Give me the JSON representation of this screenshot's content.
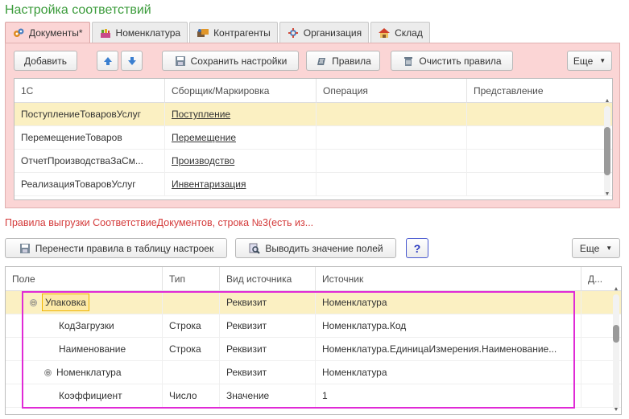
{
  "page_title": "Настройка соответствий",
  "tabs": [
    {
      "label": "Документы*",
      "icon": "documents-icon",
      "active": true
    },
    {
      "label": "Номенклатура",
      "icon": "nomenclature-icon"
    },
    {
      "label": "Контрагенты",
      "icon": "counterparties-icon"
    },
    {
      "label": "Организация",
      "icon": "organization-icon"
    },
    {
      "label": "Склад",
      "icon": "warehouse-icon"
    }
  ],
  "toolbar": {
    "add": "Добавить",
    "save_settings": "Сохранить настройки",
    "rules": "Правила",
    "clear_rules": "Очистить правила",
    "more": "Еще"
  },
  "docs_table": {
    "columns": [
      "1С",
      "Сборщик/Маркировка",
      "Операция",
      "Представление"
    ],
    "rows": [
      {
        "c1": "ПоступлениеТоваровУслуг",
        "c2": "Поступление",
        "c3": "",
        "c4": "",
        "selected": true
      },
      {
        "c1": "ПеремещениеТоваров",
        "c2": "Перемещение",
        "c3": "",
        "c4": ""
      },
      {
        "c1": "ОтчетПроизводстваЗаСм...",
        "c2": "Производство",
        "c3": "",
        "c4": ""
      },
      {
        "c1": "РеализацияТоваровУслуг",
        "c2": "Инвентаризация",
        "c3": "",
        "c4": ""
      }
    ]
  },
  "rules_title": "Правила выгрузки СоответствиеДокументов, строка №3(есть из...",
  "rules_toolbar": {
    "transfer": "Перенести правила в таблицу настроек",
    "show_values": "Выводить значение полей",
    "help": "?",
    "more": "Еще"
  },
  "fields_table": {
    "columns": [
      "Поле",
      "Тип",
      "Вид источника",
      "Источник",
      "Д..."
    ],
    "rows": [
      {
        "field": "Упаковка",
        "type": "",
        "kind": "Реквизит",
        "source": "Номенклатура",
        "level": 0,
        "toggle": "⊖",
        "selected": true
      },
      {
        "field": "КодЗагрузки",
        "type": "Строка",
        "kind": "Реквизит",
        "source": "Номенклатура.Код",
        "level": 1,
        "toggle": ""
      },
      {
        "field": "Наименование",
        "type": "Строка",
        "kind": "Реквизит",
        "source": "Номенклатура.ЕдиницаИзмерения.Наименование...",
        "level": 1,
        "toggle": ""
      },
      {
        "field": "Номенклатура",
        "type": "",
        "kind": "Реквизит",
        "source": "Номенклатура",
        "level": 1,
        "toggle": "⊕"
      },
      {
        "field": "Коэффициент",
        "type": "Число",
        "kind": "Значение",
        "source": "1",
        "level": 1,
        "toggle": ""
      }
    ]
  },
  "colors": {
    "title_green": "#3a9b3a",
    "panel_pink": "#fbd5d5",
    "selected_row": "#fbf0c2",
    "rules_red": "#d43a3a",
    "highlight_magenta": "#e02ad6"
  }
}
